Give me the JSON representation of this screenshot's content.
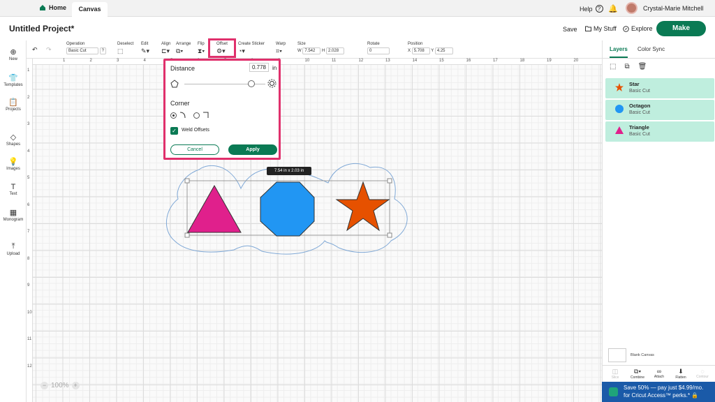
{
  "topbar": {
    "home": "Home",
    "tab": "Canvas",
    "help": "Help",
    "help_glyph": "?",
    "bell_glyph": "🔔",
    "user": "Crystal-Marie Mitchell"
  },
  "titlebar": {
    "project": "Untitled Project*",
    "save": "Save",
    "mystuff": "My Stuff",
    "explore": "Explore",
    "make": "Make"
  },
  "toolbar": {
    "operation": "Operation",
    "operation_value": "Basic Cut",
    "deselect": "Deselect",
    "edit": "Edit",
    "align": "Align",
    "arrange": "Arrange",
    "flip": "Flip",
    "offset": "Offset",
    "create_sticker": "Create Sticker",
    "warp": "Warp",
    "size": "Size",
    "w_label": "W",
    "w_value": "7.542",
    "h_label": "H",
    "h_value": "2.028",
    "rotate": "Rotate",
    "rotate_value": "0",
    "position": "Position",
    "x_label": "X",
    "x_value": "5.708",
    "y_label": "Y",
    "y_value": "4.25"
  },
  "leftbar": {
    "items": [
      {
        "label": "New",
        "glyph": "⊕"
      },
      {
        "label": "Templates",
        "glyph": "👕"
      },
      {
        "label": "Projects",
        "glyph": "📋"
      },
      {
        "label": "Shapes",
        "glyph": "◇"
      },
      {
        "label": "Images",
        "glyph": "💡"
      },
      {
        "label": "Text",
        "glyph": "T"
      },
      {
        "label": "Monogram",
        "glyph": "▦"
      },
      {
        "label": "Upload",
        "glyph": "⤒"
      }
    ]
  },
  "ruler": {
    "h": [
      "1",
      "2",
      "3",
      "4",
      "5",
      "6",
      "7",
      "8",
      "9",
      "10",
      "11",
      "12",
      "13",
      "14",
      "15",
      "16",
      "17",
      "18",
      "19",
      "20"
    ],
    "v": [
      "1",
      "2",
      "3",
      "4",
      "5",
      "6",
      "7",
      "8",
      "9",
      "10",
      "11",
      "12"
    ]
  },
  "offset_popup": {
    "distance_label": "Distance",
    "distance_value": "0.778",
    "unit": "in",
    "corner_label": "Corner",
    "weld_label": "Weld Offsets",
    "weld_checked": true,
    "cancel": "Cancel",
    "apply": "Apply"
  },
  "canvas": {
    "dimensions": "7.54  in x 2.03  in",
    "zoom": "100%",
    "zoom_minus": "−",
    "zoom_plus": "+",
    "shapes": [
      {
        "name": "Triangle",
        "color": "#e0208c"
      },
      {
        "name": "Octagon",
        "color": "#2196f3"
      },
      {
        "name": "Star",
        "color": "#e65100"
      }
    ]
  },
  "layers": {
    "tab_layers": "Layers",
    "tab_color_sync": "Color Sync",
    "items": [
      {
        "name": "Star",
        "type": "Basic Cut",
        "color": "#e65100",
        "icon": "star-icon"
      },
      {
        "name": "Octagon",
        "type": "Basic Cut",
        "color": "#2196f3",
        "icon": "circle-icon"
      },
      {
        "name": "Triangle",
        "type": "Basic Cut",
        "color": "#e0208c",
        "icon": "triangle-icon"
      }
    ],
    "blank_canvas": "Blank Canvas",
    "bottom_tools": [
      "Slice",
      "Combine",
      "Attach",
      "Flatten",
      "Contour"
    ]
  },
  "promo": {
    "line1": "Save 50% — pay just $4.99/mo.",
    "line2": "for Cricut Access™ perks.* 🔒"
  }
}
